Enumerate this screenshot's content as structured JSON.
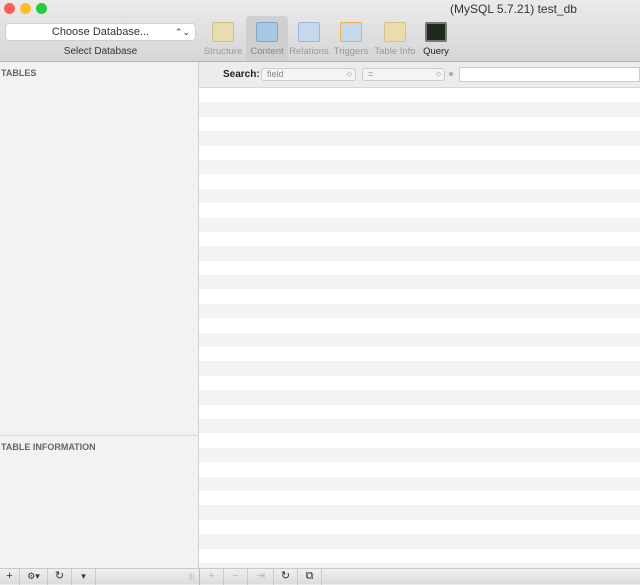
{
  "window": {
    "title": "(MySQL 5.7.21) test_db"
  },
  "toolbar": {
    "database_select": {
      "value": "Choose Database...",
      "label": "Select Database"
    },
    "tabs": [
      {
        "label": "Structure",
        "icon": "structure-icon"
      },
      {
        "label": "Content",
        "icon": "content-icon"
      },
      {
        "label": "Relations",
        "icon": "relations-icon"
      },
      {
        "label": "Triggers",
        "icon": "triggers-icon"
      },
      {
        "label": "Table Info",
        "icon": "table-info-icon"
      },
      {
        "label": "Query",
        "icon": "query-icon"
      }
    ],
    "active_tab": "Content"
  },
  "sidebar": {
    "tables_header": "TABLES",
    "info_header": "TABLE INFORMATION"
  },
  "search": {
    "label": "Search:",
    "field_value": "field",
    "operator_value": "=",
    "input_value": ""
  },
  "bottom": {
    "add": "+",
    "gear": "⚙▾",
    "refresh": "↻",
    "filter": "▾",
    "grip": "|||",
    "add_row": "+",
    "remove_row": "−",
    "duplicate": "⇥",
    "refresh_content": "↻",
    "copy": "⧉"
  }
}
